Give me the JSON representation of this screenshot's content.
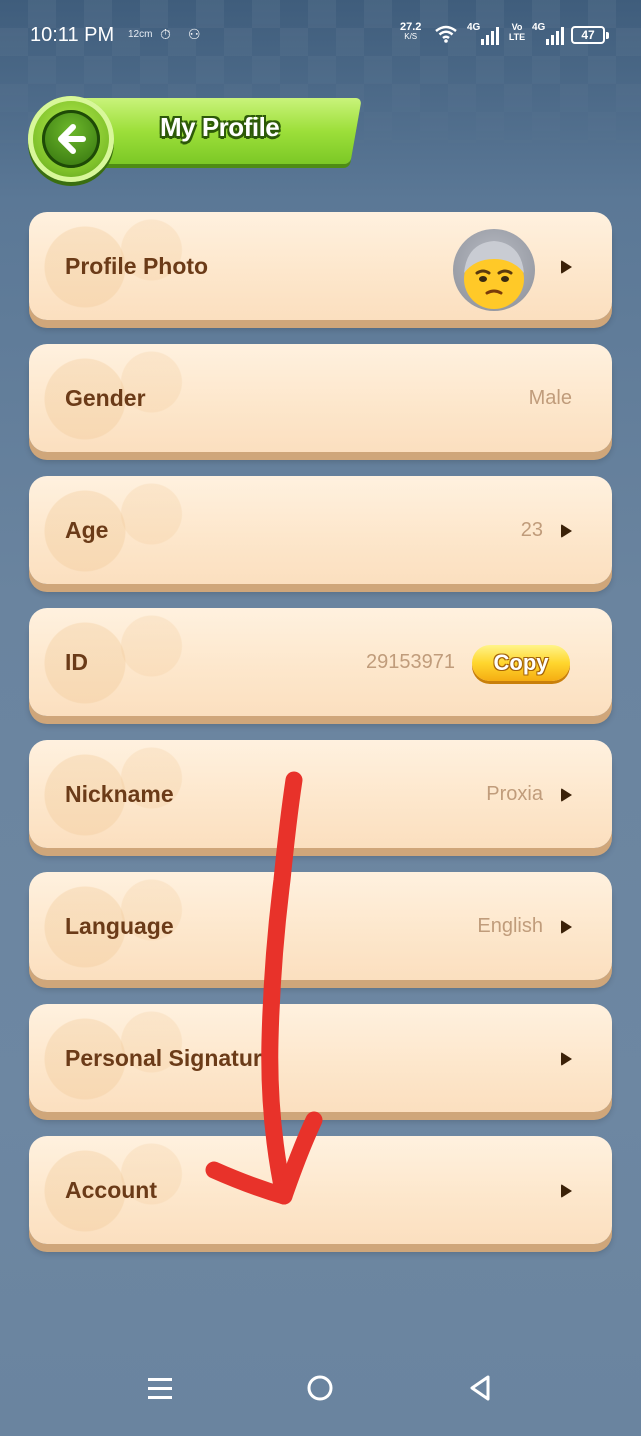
{
  "status_bar": {
    "time": "10:11 PM",
    "speed_label": "12cm",
    "net_speed": "27.2",
    "net_speed_unit": "K/S",
    "signal1": "4G",
    "volte": "Vo LTE",
    "signal2": "4G",
    "battery": "47"
  },
  "header": {
    "title": "My Profile",
    "back_icon": "back-arrow-icon"
  },
  "rows": [
    {
      "label": "Profile Photo",
      "value": "",
      "has_avatar": true,
      "has_chevron": true
    },
    {
      "label": "Gender",
      "value": "Male",
      "has_chevron": false
    },
    {
      "label": "Age",
      "value": "23",
      "has_chevron": true
    },
    {
      "label": "ID",
      "value": "29153971",
      "copy_label": "Copy",
      "has_chevron": false
    },
    {
      "label": "Nickname",
      "value": "Proxia",
      "has_chevron": true
    },
    {
      "label": "Language",
      "value": "English",
      "has_chevron": true
    },
    {
      "label": "Personal Signatur",
      "value": "",
      "has_chevron": true
    },
    {
      "label": "Account",
      "value": "",
      "has_chevron": true
    }
  ],
  "colors": {
    "row_label": "#6b3b18",
    "row_value": "#c09c7b",
    "annotation": "#e8322a",
    "header_green": "#9ddf3a"
  },
  "nav": {
    "menu_icon": "menu-icon",
    "home_icon": "home-icon",
    "back_icon": "nav-back-icon"
  }
}
